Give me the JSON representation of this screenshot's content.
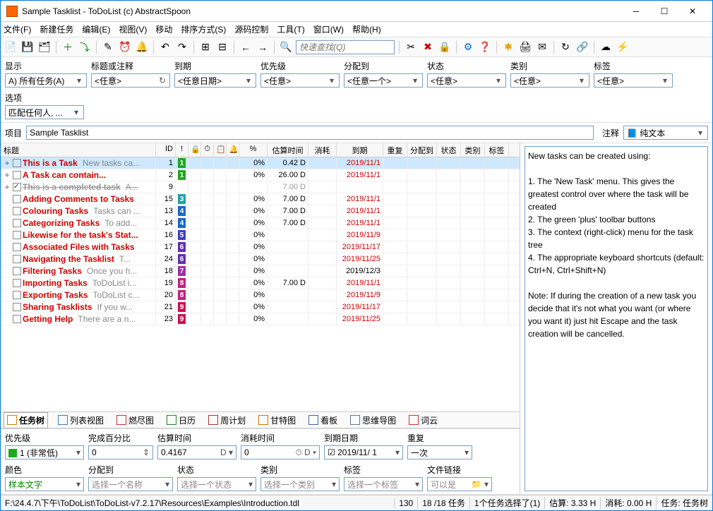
{
  "window_title": "Sample Tasklist - ToDoList (c) AbstractSpoon",
  "menus": [
    "文件(F)",
    "新建任务",
    "编辑(E)",
    "视图(V)",
    "移动",
    "排序方式(S)",
    "源码控制",
    "工具(T)",
    "窗口(W)",
    "帮助(H)"
  ],
  "quickfind_placeholder": "快速查找(Q)",
  "filters": {
    "display": {
      "label": "显示",
      "value": "A) 所有任务(A)"
    },
    "title": {
      "label": "标题或注释",
      "value": "<任意>"
    },
    "due": {
      "label": "到期",
      "value": "<任意日期>"
    },
    "priority": {
      "label": "优先级",
      "value": "<任意>"
    },
    "assigned": {
      "label": "分配到",
      "value": "<任意一个>"
    },
    "status": {
      "label": "状态",
      "value": "<任意>"
    },
    "category": {
      "label": "类别",
      "value": "<任意>"
    },
    "tag": {
      "label": "标签",
      "value": "<任意>"
    },
    "option": {
      "label": "选项",
      "value": "匹配任何人, ..."
    }
  },
  "project_label": "项目",
  "project_name": "Sample Tasklist",
  "comment_label": "注释",
  "comment_type": "纯文本",
  "comments": "New tasks can be created using:\n\n1. The 'New Task' menu. This gives the greatest control over where the task will be created\n2. The green 'plus' toolbar buttons\n3. The context (right-click) menu for the task tree\n4. The appropriate keyboard shortcuts (default: Ctrl+N, Ctrl+Shift+N)\n\nNote: If during the creation of a new task you decide that it's not what you want (or where you want it) just hit Escape and the task creation will be cancelled.",
  "columns": {
    "title": "标题",
    "id": "ID",
    "pct": "%",
    "est": "估算时间",
    "spent": "消耗",
    "due": "到期",
    "rep": "重复",
    "assign": "分配到",
    "stat": "状态",
    "cat": "类别",
    "tag": "标签"
  },
  "tasks": [
    {
      "exp": "+",
      "chk": "",
      "title": "This is a Task",
      "note": "New tasks ca...",
      "id": 1,
      "prio": 1,
      "prioColor": "#1fa81f",
      "pct": "0%",
      "est": "0.42 D",
      "spent": "",
      "due": "2019/11/1",
      "dueCls": "over",
      "selected": true
    },
    {
      "exp": "+",
      "chk": "",
      "title": "A Task can contain...",
      "note": "",
      "id": 2,
      "prio": 1,
      "prioColor": "#1fa81f",
      "pct": "0%",
      "est": "26.00 D",
      "spent": "",
      "due": "2019/11/1",
      "dueCls": "over"
    },
    {
      "exp": "+",
      "chk": "checked",
      "title": "This is a completed task",
      "note": "A...",
      "id": 9,
      "prio": "",
      "prioColor": "",
      "pct": "",
      "est": "7.00 D",
      "spent": "",
      "due": "",
      "completed": true,
      "estGrey": true
    },
    {
      "exp": "",
      "chk": "",
      "title": "Adding Comments to Tasks",
      "note": "",
      "id": 15,
      "prio": 3,
      "prioColor": "#1aa3a3",
      "pct": "0%",
      "est": "7.00 D",
      "spent": "",
      "due": "2019/11/1",
      "dueCls": "over"
    },
    {
      "exp": "",
      "chk": "",
      "title": "Colouring Tasks",
      "note": "Tasks can ...",
      "id": 13,
      "prio": 4,
      "prioColor": "#1a66cc",
      "pct": "0%",
      "est": "7.00 D",
      "spent": "",
      "due": "2019/11/1",
      "dueCls": "over"
    },
    {
      "exp": "",
      "chk": "",
      "title": "Categorizing Tasks",
      "note": "To add...",
      "id": 14,
      "prio": 4,
      "prioColor": "#1a66cc",
      "pct": "0%",
      "est": "7.00 D",
      "spent": "",
      "due": "2019/11/1",
      "dueCls": "over"
    },
    {
      "exp": "",
      "chk": "",
      "title": "Likewise for the task's Stat...",
      "note": "",
      "id": 16,
      "prio": 5,
      "prioColor": "#4040c0",
      "pct": "0%",
      "est": "",
      "spent": "",
      "due": "2019/11/9",
      "dueCls": "over"
    },
    {
      "exp": "",
      "chk": "",
      "title": "Associated Files with Tasks",
      "note": "",
      "id": 17,
      "prio": 6,
      "prioColor": "#6030b0",
      "pct": "0%",
      "est": "",
      "spent": "",
      "due": "2019/11/17",
      "dueCls": "over"
    },
    {
      "exp": "",
      "chk": "",
      "title": "Navigating the Tasklist",
      "note": "T...",
      "id": 24,
      "prio": 6,
      "prioColor": "#6030b0",
      "pct": "0%",
      "est": "",
      "spent": "",
      "due": "2019/11/25",
      "dueCls": "over"
    },
    {
      "exp": "",
      "chk": "",
      "title": "Filtering Tasks",
      "note": "Once you h...",
      "id": 18,
      "prio": 7,
      "prioColor": "#a030a0",
      "pct": "0%",
      "est": "",
      "spent": "",
      "due": "2019/12/3",
      "dueCls": ""
    },
    {
      "exp": "",
      "chk": "",
      "title": "Importing Tasks",
      "note": "ToDoList i...",
      "id": 19,
      "prio": 8,
      "prioColor": "#c02080",
      "pct": "0%",
      "est": "7.00 D",
      "spent": "",
      "due": "2019/11/1",
      "dueCls": "over"
    },
    {
      "exp": "",
      "chk": "",
      "title": "Exporting Tasks",
      "note": "ToDoList c...",
      "id": 20,
      "prio": 8,
      "prioColor": "#c02080",
      "pct": "0%",
      "est": "",
      "spent": "",
      "due": "2019/11/9",
      "dueCls": "over"
    },
    {
      "exp": "",
      "chk": "",
      "title": "Sharing Tasklists",
      "note": "If you w...",
      "id": 21,
      "prio": 9,
      "prioColor": "#d01050",
      "pct": "0%",
      "est": "",
      "spent": "",
      "due": "2019/11/17",
      "dueCls": "over"
    },
    {
      "exp": "",
      "chk": "",
      "title": "Getting Help",
      "note": "There are a n...",
      "id": 23,
      "prio": 9,
      "prioColor": "#d01050",
      "pct": "0%",
      "est": "",
      "spent": "",
      "due": "2019/11/25",
      "dueCls": "over"
    }
  ],
  "viewtabs": [
    {
      "label": "任务树",
      "active": true,
      "color": "#d08000"
    },
    {
      "label": "列表视图",
      "color": "#3080d0"
    },
    {
      "label": "燃尽图",
      "color": "#cc3333"
    },
    {
      "label": "日历",
      "color": "#228822"
    },
    {
      "label": "周计划",
      "color": "#aa3333"
    },
    {
      "label": "甘特图",
      "color": "#cc7700"
    },
    {
      "label": "看板",
      "color": "#4466aa"
    },
    {
      "label": "思维导图",
      "color": "#667788"
    },
    {
      "label": "词云",
      "color": "#cc3333"
    }
  ],
  "attrs": {
    "priority": {
      "label": "优先级",
      "value": "1 (非常低)",
      "color": "#1fa81f"
    },
    "pct": {
      "label": "完成百分比",
      "value": "0"
    },
    "est": {
      "label": "估算时间",
      "value": "0.4167"
    },
    "spent": {
      "label": "消耗时间",
      "value": "0"
    },
    "due": {
      "label": "到期日期",
      "value": "2019/11/ 1"
    },
    "repeat": {
      "label": "重复",
      "value": "一次"
    },
    "color": {
      "label": "颜色",
      "value": "样本文字"
    },
    "assigned": {
      "label": "分配到",
      "value": "选择一个名称"
    },
    "status": {
      "label": "状态",
      "value": "选择一个状态"
    },
    "category": {
      "label": "类别",
      "value": "选择一个类别"
    },
    "tag": {
      "label": "标签",
      "value": "选择一个标签"
    },
    "filelink": {
      "label": "文件链接",
      "value": "可以是"
    }
  },
  "statusbar": {
    "path": "F:\\24.4.7\\下午\\ToDoList\\ToDoList-v7.2.17\\Resources\\Examples\\Introduction.tdl",
    "col": "130",
    "count": "18 /18 任务",
    "sel": "1个任务选择了(1)",
    "est": "估算:   3.33 H",
    "spent": "消耗: 0.00 H",
    "view": "任务: 任务树"
  }
}
